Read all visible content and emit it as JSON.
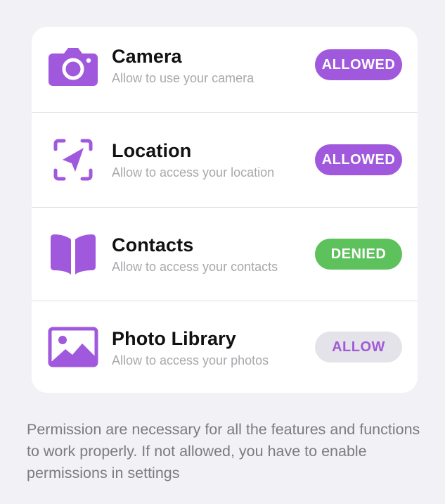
{
  "permissions": [
    {
      "name": "Camera",
      "description": "Allow to use your camera",
      "status": "ALLOWED",
      "icon": "camera-icon"
    },
    {
      "name": "Location",
      "description": "Allow to access your location",
      "status": "ALLOWED",
      "icon": "location-icon"
    },
    {
      "name": "Contacts",
      "description": "Allow to access your contacts",
      "status": "DENIED",
      "icon": "book-icon"
    },
    {
      "name": "Photo Library",
      "description": "Allow to access your photos",
      "status": "ALLOW",
      "icon": "photo-icon"
    }
  ],
  "footer": {
    "text": "Permission are necessary for all the features and functions to work properly. If not allowed, you have to enable permissions in settings"
  },
  "colors": {
    "background": "#f2f1f6",
    "accent_purple": "#a059dc",
    "denied_green": "#5dc15c",
    "neutral_button": "#e4e3e9"
  }
}
